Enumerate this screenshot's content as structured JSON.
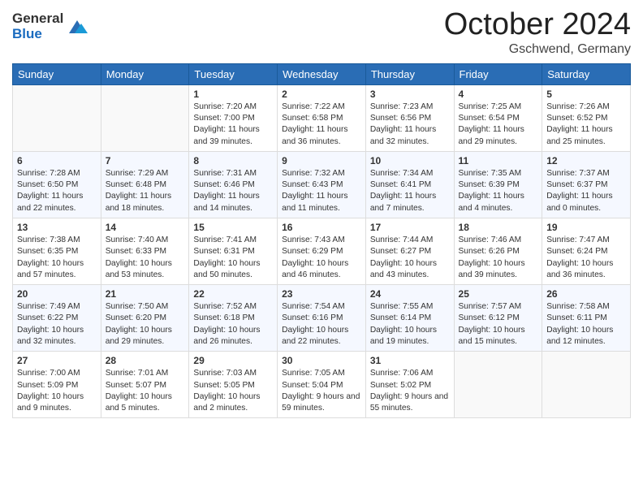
{
  "header": {
    "logo": {
      "general": "General",
      "blue": "Blue"
    },
    "title": "October 2024",
    "location": "Gschwend, Germany"
  },
  "weekdays": [
    "Sunday",
    "Monday",
    "Tuesday",
    "Wednesday",
    "Thursday",
    "Friday",
    "Saturday"
  ],
  "weeks": [
    [
      {
        "day": "",
        "info": ""
      },
      {
        "day": "",
        "info": ""
      },
      {
        "day": "1",
        "info": "Sunrise: 7:20 AM\nSunset: 7:00 PM\nDaylight: 11 hours and 39 minutes."
      },
      {
        "day": "2",
        "info": "Sunrise: 7:22 AM\nSunset: 6:58 PM\nDaylight: 11 hours and 36 minutes."
      },
      {
        "day": "3",
        "info": "Sunrise: 7:23 AM\nSunset: 6:56 PM\nDaylight: 11 hours and 32 minutes."
      },
      {
        "day": "4",
        "info": "Sunrise: 7:25 AM\nSunset: 6:54 PM\nDaylight: 11 hours and 29 minutes."
      },
      {
        "day": "5",
        "info": "Sunrise: 7:26 AM\nSunset: 6:52 PM\nDaylight: 11 hours and 25 minutes."
      }
    ],
    [
      {
        "day": "6",
        "info": "Sunrise: 7:28 AM\nSunset: 6:50 PM\nDaylight: 11 hours and 22 minutes."
      },
      {
        "day": "7",
        "info": "Sunrise: 7:29 AM\nSunset: 6:48 PM\nDaylight: 11 hours and 18 minutes."
      },
      {
        "day": "8",
        "info": "Sunrise: 7:31 AM\nSunset: 6:46 PM\nDaylight: 11 hours and 14 minutes."
      },
      {
        "day": "9",
        "info": "Sunrise: 7:32 AM\nSunset: 6:43 PM\nDaylight: 11 hours and 11 minutes."
      },
      {
        "day": "10",
        "info": "Sunrise: 7:34 AM\nSunset: 6:41 PM\nDaylight: 11 hours and 7 minutes."
      },
      {
        "day": "11",
        "info": "Sunrise: 7:35 AM\nSunset: 6:39 PM\nDaylight: 11 hours and 4 minutes."
      },
      {
        "day": "12",
        "info": "Sunrise: 7:37 AM\nSunset: 6:37 PM\nDaylight: 11 hours and 0 minutes."
      }
    ],
    [
      {
        "day": "13",
        "info": "Sunrise: 7:38 AM\nSunset: 6:35 PM\nDaylight: 10 hours and 57 minutes."
      },
      {
        "day": "14",
        "info": "Sunrise: 7:40 AM\nSunset: 6:33 PM\nDaylight: 10 hours and 53 minutes."
      },
      {
        "day": "15",
        "info": "Sunrise: 7:41 AM\nSunset: 6:31 PM\nDaylight: 10 hours and 50 minutes."
      },
      {
        "day": "16",
        "info": "Sunrise: 7:43 AM\nSunset: 6:29 PM\nDaylight: 10 hours and 46 minutes."
      },
      {
        "day": "17",
        "info": "Sunrise: 7:44 AM\nSunset: 6:27 PM\nDaylight: 10 hours and 43 minutes."
      },
      {
        "day": "18",
        "info": "Sunrise: 7:46 AM\nSunset: 6:26 PM\nDaylight: 10 hours and 39 minutes."
      },
      {
        "day": "19",
        "info": "Sunrise: 7:47 AM\nSunset: 6:24 PM\nDaylight: 10 hours and 36 minutes."
      }
    ],
    [
      {
        "day": "20",
        "info": "Sunrise: 7:49 AM\nSunset: 6:22 PM\nDaylight: 10 hours and 32 minutes."
      },
      {
        "day": "21",
        "info": "Sunrise: 7:50 AM\nSunset: 6:20 PM\nDaylight: 10 hours and 29 minutes."
      },
      {
        "day": "22",
        "info": "Sunrise: 7:52 AM\nSunset: 6:18 PM\nDaylight: 10 hours and 26 minutes."
      },
      {
        "day": "23",
        "info": "Sunrise: 7:54 AM\nSunset: 6:16 PM\nDaylight: 10 hours and 22 minutes."
      },
      {
        "day": "24",
        "info": "Sunrise: 7:55 AM\nSunset: 6:14 PM\nDaylight: 10 hours and 19 minutes."
      },
      {
        "day": "25",
        "info": "Sunrise: 7:57 AM\nSunset: 6:12 PM\nDaylight: 10 hours and 15 minutes."
      },
      {
        "day": "26",
        "info": "Sunrise: 7:58 AM\nSunset: 6:11 PM\nDaylight: 10 hours and 12 minutes."
      }
    ],
    [
      {
        "day": "27",
        "info": "Sunrise: 7:00 AM\nSunset: 5:09 PM\nDaylight: 10 hours and 9 minutes."
      },
      {
        "day": "28",
        "info": "Sunrise: 7:01 AM\nSunset: 5:07 PM\nDaylight: 10 hours and 5 minutes."
      },
      {
        "day": "29",
        "info": "Sunrise: 7:03 AM\nSunset: 5:05 PM\nDaylight: 10 hours and 2 minutes."
      },
      {
        "day": "30",
        "info": "Sunrise: 7:05 AM\nSunset: 5:04 PM\nDaylight: 9 hours and 59 minutes."
      },
      {
        "day": "31",
        "info": "Sunrise: 7:06 AM\nSunset: 5:02 PM\nDaylight: 9 hours and 55 minutes."
      },
      {
        "day": "",
        "info": ""
      },
      {
        "day": "",
        "info": ""
      }
    ]
  ]
}
